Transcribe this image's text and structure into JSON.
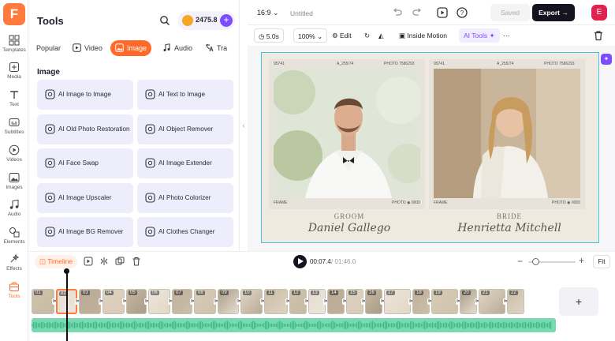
{
  "app": {
    "logo_letter": "F"
  },
  "rail": [
    {
      "label": "Templates",
      "icon": "templates-icon"
    },
    {
      "label": "Media",
      "icon": "media-icon"
    },
    {
      "label": "Text",
      "icon": "text-icon"
    },
    {
      "label": "Subtitles",
      "icon": "subtitles-icon"
    },
    {
      "label": "Videos",
      "icon": "videos-icon"
    },
    {
      "label": "Images",
      "icon": "images-icon"
    },
    {
      "label": "Audio",
      "icon": "audio-icon"
    },
    {
      "label": "Elements",
      "icon": "elements-icon"
    },
    {
      "label": "Effects",
      "icon": "effects-icon"
    },
    {
      "label": "Tools",
      "icon": "tools-icon",
      "active": true
    }
  ],
  "tools_panel": {
    "title": "Tools",
    "credits": "2475.8",
    "plus": "+",
    "tabs": [
      "Popular",
      "Video",
      "Image",
      "Audio",
      "Tra"
    ],
    "active_tab": "Image",
    "section_title": "Image",
    "items": [
      "AI Image to Image",
      "AI Text to Image",
      "AI Old Photo Restoration",
      "AI Object Remover",
      "AI Face Swap",
      "AI Image Extender",
      "AI Image Upscaler",
      "AI Photo Colorizer",
      "AI Image BG Remover",
      "AI Clothes Changer"
    ]
  },
  "topbar": {
    "ratio": "16:9",
    "project_title": "Untitled",
    "saved": "Saved",
    "export": "Export",
    "avatar": "E"
  },
  "edit_bar": {
    "duration": "5.0s",
    "zoom": "100%",
    "edit": "Edit",
    "inside_motion": "Inside Motion",
    "ai_tools": "AI Tools"
  },
  "canvas": {
    "left": {
      "top_left": "95741",
      "top_mid": "A_255/74",
      "top_right": "PHOTO 7586293",
      "bot_left": "FRAME",
      "bot_right": "PHOTO ◉ 0000",
      "role": "GROOM",
      "name": "Daniel Gallego"
    },
    "right": {
      "top_left": "95741",
      "top_mid": "A_255/74",
      "top_right": "PHOTO 7586293",
      "bot_left": "FRAME",
      "bot_right": "PHOTO ◉ 0000",
      "role": "BRIDE",
      "name": "Henrietta Mitchell"
    }
  },
  "timeline": {
    "label": "Timeline",
    "current_time": "00:07.4",
    "total_time": "/ 01:46.0",
    "fit": "Fit",
    "zoom_level": 0.08,
    "clips": [
      "01",
      "02",
      "03",
      "04",
      "05",
      "06",
      "07",
      "08",
      "09",
      "10",
      "11",
      "12",
      "13",
      "14",
      "15",
      "16",
      "17",
      "18",
      "19",
      "20",
      "21",
      "22"
    ],
    "selected_clip": "02",
    "add": "+"
  }
}
